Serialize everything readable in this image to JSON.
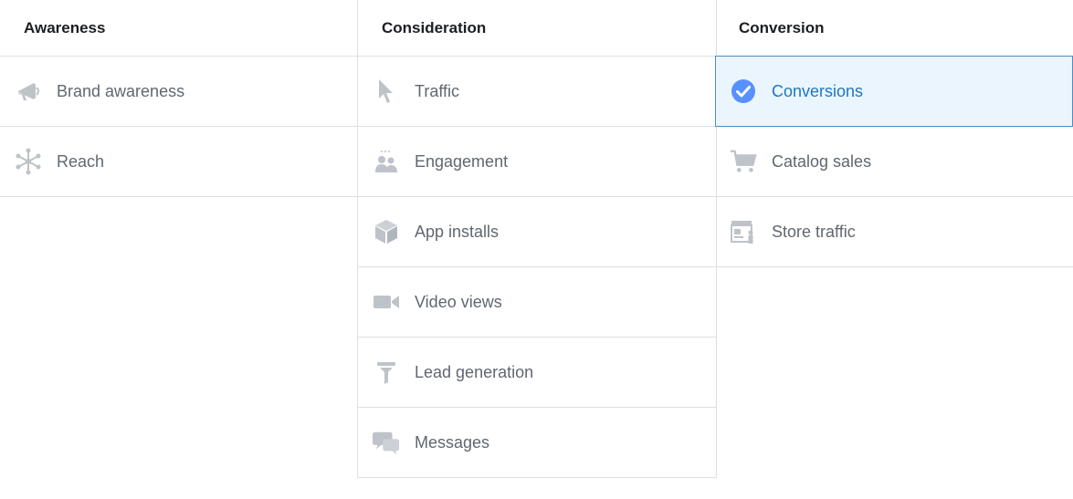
{
  "columns": [
    {
      "title": "Awareness",
      "items": [
        {
          "label": "Brand awareness",
          "icon": "megaphone-icon"
        },
        {
          "label": "Reach",
          "icon": "reach-icon"
        }
      ]
    },
    {
      "title": "Consideration",
      "items": [
        {
          "label": "Traffic",
          "icon": "cursor-icon"
        },
        {
          "label": "Engagement",
          "icon": "people-icon"
        },
        {
          "label": "App installs",
          "icon": "box-icon"
        },
        {
          "label": "Video views",
          "icon": "video-camera-icon"
        },
        {
          "label": "Lead generation",
          "icon": "funnel-icon"
        },
        {
          "label": "Messages",
          "icon": "chat-bubbles-icon"
        }
      ]
    },
    {
      "title": "Conversion",
      "items": [
        {
          "label": "Conversions",
          "icon": "check-circle-icon",
          "selected": true
        },
        {
          "label": "Catalog sales",
          "icon": "cart-icon"
        },
        {
          "label": "Store traffic",
          "icon": "store-icon"
        }
      ]
    }
  ],
  "colors": {
    "icon": "#bec3c9",
    "selected_bg": "#ebf5fd",
    "selected_border": "#4a8ec4",
    "selected_text": "#1d77c2",
    "check": "#5890ff",
    "text": "#606770",
    "header": "#1c1e21",
    "divider": "#dddfe2"
  }
}
